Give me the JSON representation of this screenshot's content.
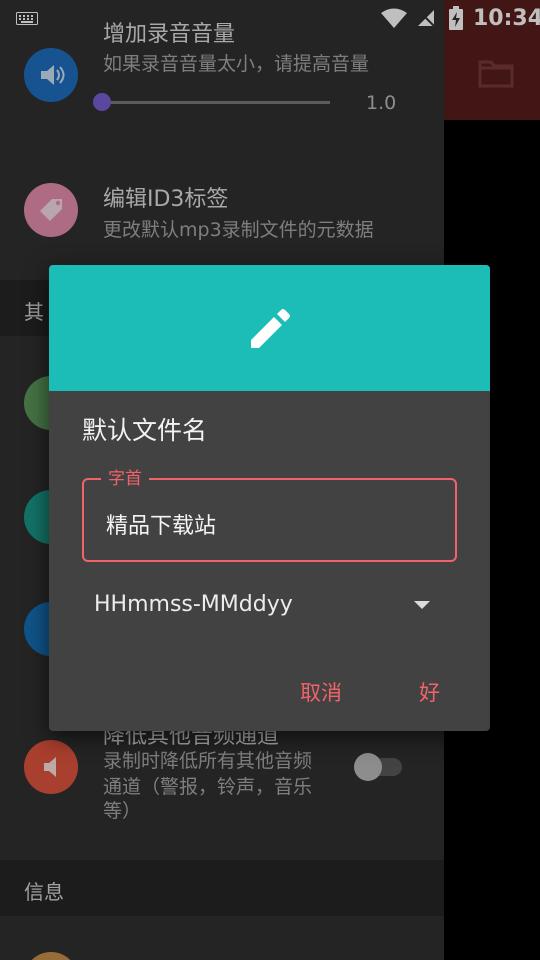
{
  "status_bar": {
    "time": "10:34"
  },
  "settings": {
    "increase_volume": {
      "title": "增加录音音量",
      "subtitle": "如果录音音量太小，请提高音量",
      "slider_value": "1.0",
      "slider_level": 0.0,
      "icon": "volume-icon",
      "icon_color": "#1e6fc0"
    },
    "edit_id3": {
      "title": "编辑ID3标签",
      "subtitle": "更改默认mp3录制文件的元数据",
      "icon": "tag-icon",
      "icon_color": "#e88fb0"
    },
    "other_section_header": "其",
    "lower_audio": {
      "title": "降低其他音频通道",
      "subtitle_lines": [
        "录制时降低所有其他音频",
        "通道（警报，铃声，音乐",
        "等）"
      ],
      "icon": "speaker-icon",
      "icon_color": "#e2553e",
      "switch_on": false
    },
    "info_section_header": "信息"
  },
  "dialog": {
    "header_icon": "pencil-icon",
    "header_color": "#1cbdb7",
    "title": "默认文件名",
    "prefix_field": {
      "label": "字首",
      "value": "精品下载站"
    },
    "format_select": {
      "value": "HHmmss-MMddyy"
    },
    "cancel_label": "取消",
    "ok_label": "好",
    "accent_color": "#f0636b"
  }
}
